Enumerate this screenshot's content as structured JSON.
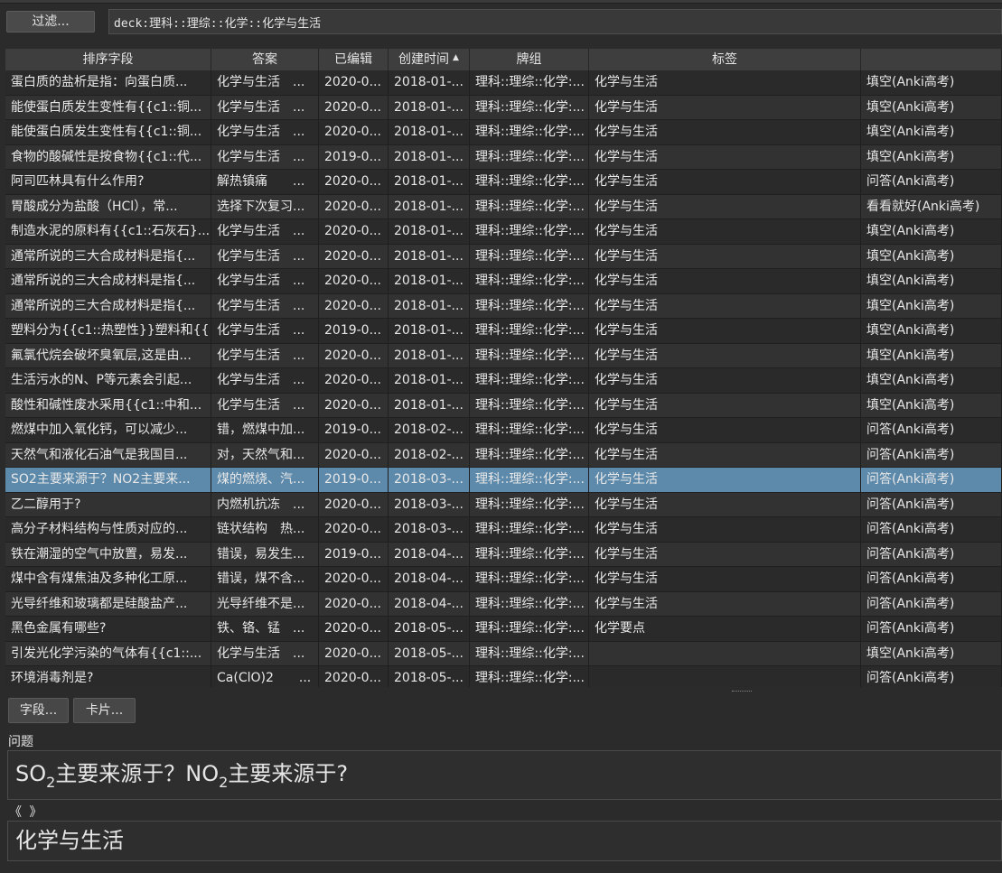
{
  "toolbar": {
    "filter_label": "过滤...",
    "search_value": "deck:理科::理综::化学::化学与生活"
  },
  "table": {
    "columns": [
      "排序字段",
      "答案",
      "已编辑",
      "创建时间",
      "牌组",
      "标签",
      ""
    ],
    "sort_column": "创建时间",
    "selected_row": 16,
    "rows": [
      [
        "蛋白质的盐析是指：向蛋白质...",
        "化学与生活　...",
        "2020-0...",
        "2018-01-...",
        "理科::理综::化学:...",
        "化学与生活",
        "填空(Anki高考)"
      ],
      [
        "能使蛋白质发生变性有{{c1::铜...",
        "化学与生活　...",
        "2020-0...",
        "2018-01-...",
        "理科::理综::化学:...",
        "化学与生活",
        "填空(Anki高考)"
      ],
      [
        "能使蛋白质发生变性有{{c1::铜...",
        "化学与生活　...",
        "2020-0...",
        "2018-01-...",
        "理科::理综::化学:...",
        "化学与生活",
        "填空(Anki高考)"
      ],
      [
        "食物的酸碱性是按食物{{c1::代...",
        "化学与生活　...",
        "2019-0...",
        "2018-01-...",
        "理科::理综::化学:...",
        "化学与生活",
        "填空(Anki高考)"
      ],
      [
        "阿司匹林具有什么作用?",
        "解热镇痛　　...",
        "2020-0...",
        "2018-01-...",
        "理科::理综::化学:...",
        "化学与生活",
        "问答(Anki高考)"
      ],
      [
        "胃酸成分为盐酸（HCl），常...",
        "选择下次复习...",
        "2020-0...",
        "2018-01-...",
        "理科::理综::化学:...",
        "化学与生活",
        "看看就好(Anki高考)"
      ],
      [
        "制造水泥的原料有{{c1::石灰石}...",
        "化学与生活　...",
        "2020-0...",
        "2018-01-...",
        "理科::理综::化学:...",
        "化学与生活",
        "填空(Anki高考)"
      ],
      [
        "通常所说的三大合成材料是指{...",
        "化学与生活　...",
        "2020-0...",
        "2018-01-...",
        "理科::理综::化学:...",
        "化学与生活",
        "填空(Anki高考)"
      ],
      [
        "通常所说的三大合成材料是指{...",
        "化学与生活　...",
        "2020-0...",
        "2018-01-...",
        "理科::理综::化学:...",
        "化学与生活",
        "填空(Anki高考)"
      ],
      [
        "通常所说的三大合成材料是指{...",
        "化学与生活　...",
        "2020-0...",
        "2018-01-...",
        "理科::理综::化学:...",
        "化学与生活",
        "填空(Anki高考)"
      ],
      [
        "塑料分为{{c1::热塑性}}塑料和{{...",
        "化学与生活　...",
        "2019-0...",
        "2018-01-...",
        "理科::理综::化学:...",
        "化学与生活",
        "填空(Anki高考)"
      ],
      [
        "氟氯代烷会破坏臭氧层,这是由...",
        "化学与生活　...",
        "2020-0...",
        "2018-01-...",
        "理科::理综::化学:...",
        "化学与生活",
        "填空(Anki高考)"
      ],
      [
        "生活污水的N、P等元素会引起...",
        "化学与生活　...",
        "2020-0...",
        "2018-01-...",
        "理科::理综::化学:...",
        "化学与生活",
        "填空(Anki高考)"
      ],
      [
        "酸性和碱性废水采用{{c1::中和...",
        "化学与生活　...",
        "2020-0...",
        "2018-01-...",
        "理科::理综::化学:...",
        "化学与生活",
        "填空(Anki高考)"
      ],
      [
        "燃煤中加入氧化钙，可以减少...",
        "错，燃煤中加...",
        "2019-0...",
        "2018-02-...",
        "理科::理综::化学:...",
        "化学与生活",
        "问答(Anki高考)"
      ],
      [
        "天然气和液化石油气是我国目...",
        "对，天然气和...",
        "2020-0...",
        "2018-02-...",
        "理科::理综::化学:...",
        "化学与生活",
        "问答(Anki高考)"
      ],
      [
        "SO2主要来源于？NO2主要来...",
        "煤的燃烧、汽...",
        "2019-0...",
        "2018-03-...",
        "理科::理综::化学:...",
        "化学与生活",
        "问答(Anki高考)"
      ],
      [
        "乙二醇用于?",
        "内燃机抗冻　...",
        "2020-0...",
        "2018-03-...",
        "理科::理综::化学:...",
        "化学与生活",
        "问答(Anki高考)"
      ],
      [
        "高分子材料结构与性质对应的...",
        "链状结构　热...",
        "2020-0...",
        "2018-03-...",
        "理科::理综::化学:...",
        "化学与生活",
        "问答(Anki高考)"
      ],
      [
        "铁在潮湿的空气中放置，易发...",
        "错误，易发生...",
        "2019-0...",
        "2018-04-...",
        "理科::理综::化学:...",
        "化学与生活",
        "问答(Anki高考)"
      ],
      [
        "煤中含有煤焦油及多种化工原...",
        "错误，煤不含...",
        "2020-0...",
        "2018-04-...",
        "理科::理综::化学:...",
        "化学与生活",
        "问答(Anki高考)"
      ],
      [
        "光导纤维和玻璃都是硅酸盐产...",
        "光导纤维不是...",
        "2020-0...",
        "2018-04-...",
        "理科::理综::化学:...",
        "化学与生活",
        "问答(Anki高考)"
      ],
      [
        "黑色金属有哪些?",
        "铁、铬、锰　...",
        "2020-0...",
        "2018-05-...",
        "理科::理综::化学:...",
        "化学要点",
        "问答(Anki高考)"
      ],
      [
        "引发光化学污染的气体有{{c1::...",
        "化学与生活　...",
        "2020-0...",
        "2018-05-...",
        "理科::理综::化学:...",
        "",
        "填空(Anki高考)"
      ],
      [
        "环境消毒剂是?",
        "Ca(ClO)2　　...",
        "2020-0...",
        "2018-05-...",
        "理科::理综::化学:...",
        "",
        "问答(Anki高考)"
      ]
    ]
  },
  "buttons": {
    "fields_label": "字段...",
    "cards_label": "卡片..."
  },
  "editor": {
    "question_label": "问题",
    "question_part1": "SO",
    "question_sub1": "2",
    "question_part2": "主要来源于？NO",
    "question_sub2": "2",
    "question_part3": "主要来源于?",
    "nav_arrows": "《 》",
    "answer_value": "化学与生活"
  }
}
